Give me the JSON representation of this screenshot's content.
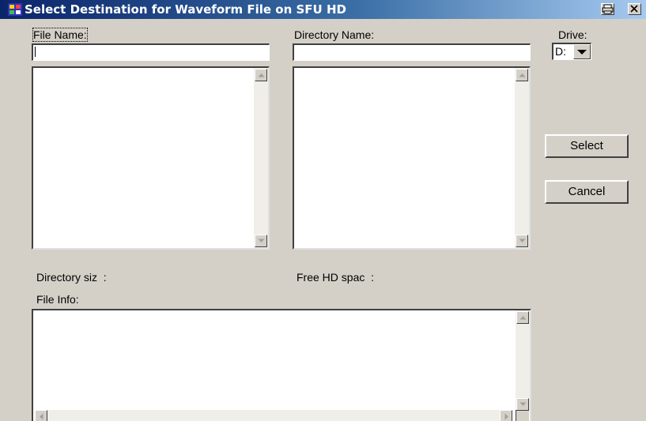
{
  "window": {
    "title": "Select Destination for Waveform File on SFU HD"
  },
  "titlebar_icons": [
    "application-icon",
    "print-icon",
    "close-icon"
  ],
  "labels": {
    "file_name": "File Name:",
    "directory_name": "Directory Name:",
    "drive": "Drive:",
    "directory_size": "Directory siz  :",
    "free_hd_space": "Free HD spac  :",
    "file_info": "File Info:"
  },
  "inputs": {
    "file_name_value": "",
    "directory_name_value": ""
  },
  "drive_select": {
    "selected": "D:"
  },
  "buttons": {
    "select": "Select",
    "cancel": "Cancel"
  },
  "colors": {
    "title_start": "#0a246a",
    "title_end": "#a6caf0",
    "face": "#d4d0c8"
  }
}
